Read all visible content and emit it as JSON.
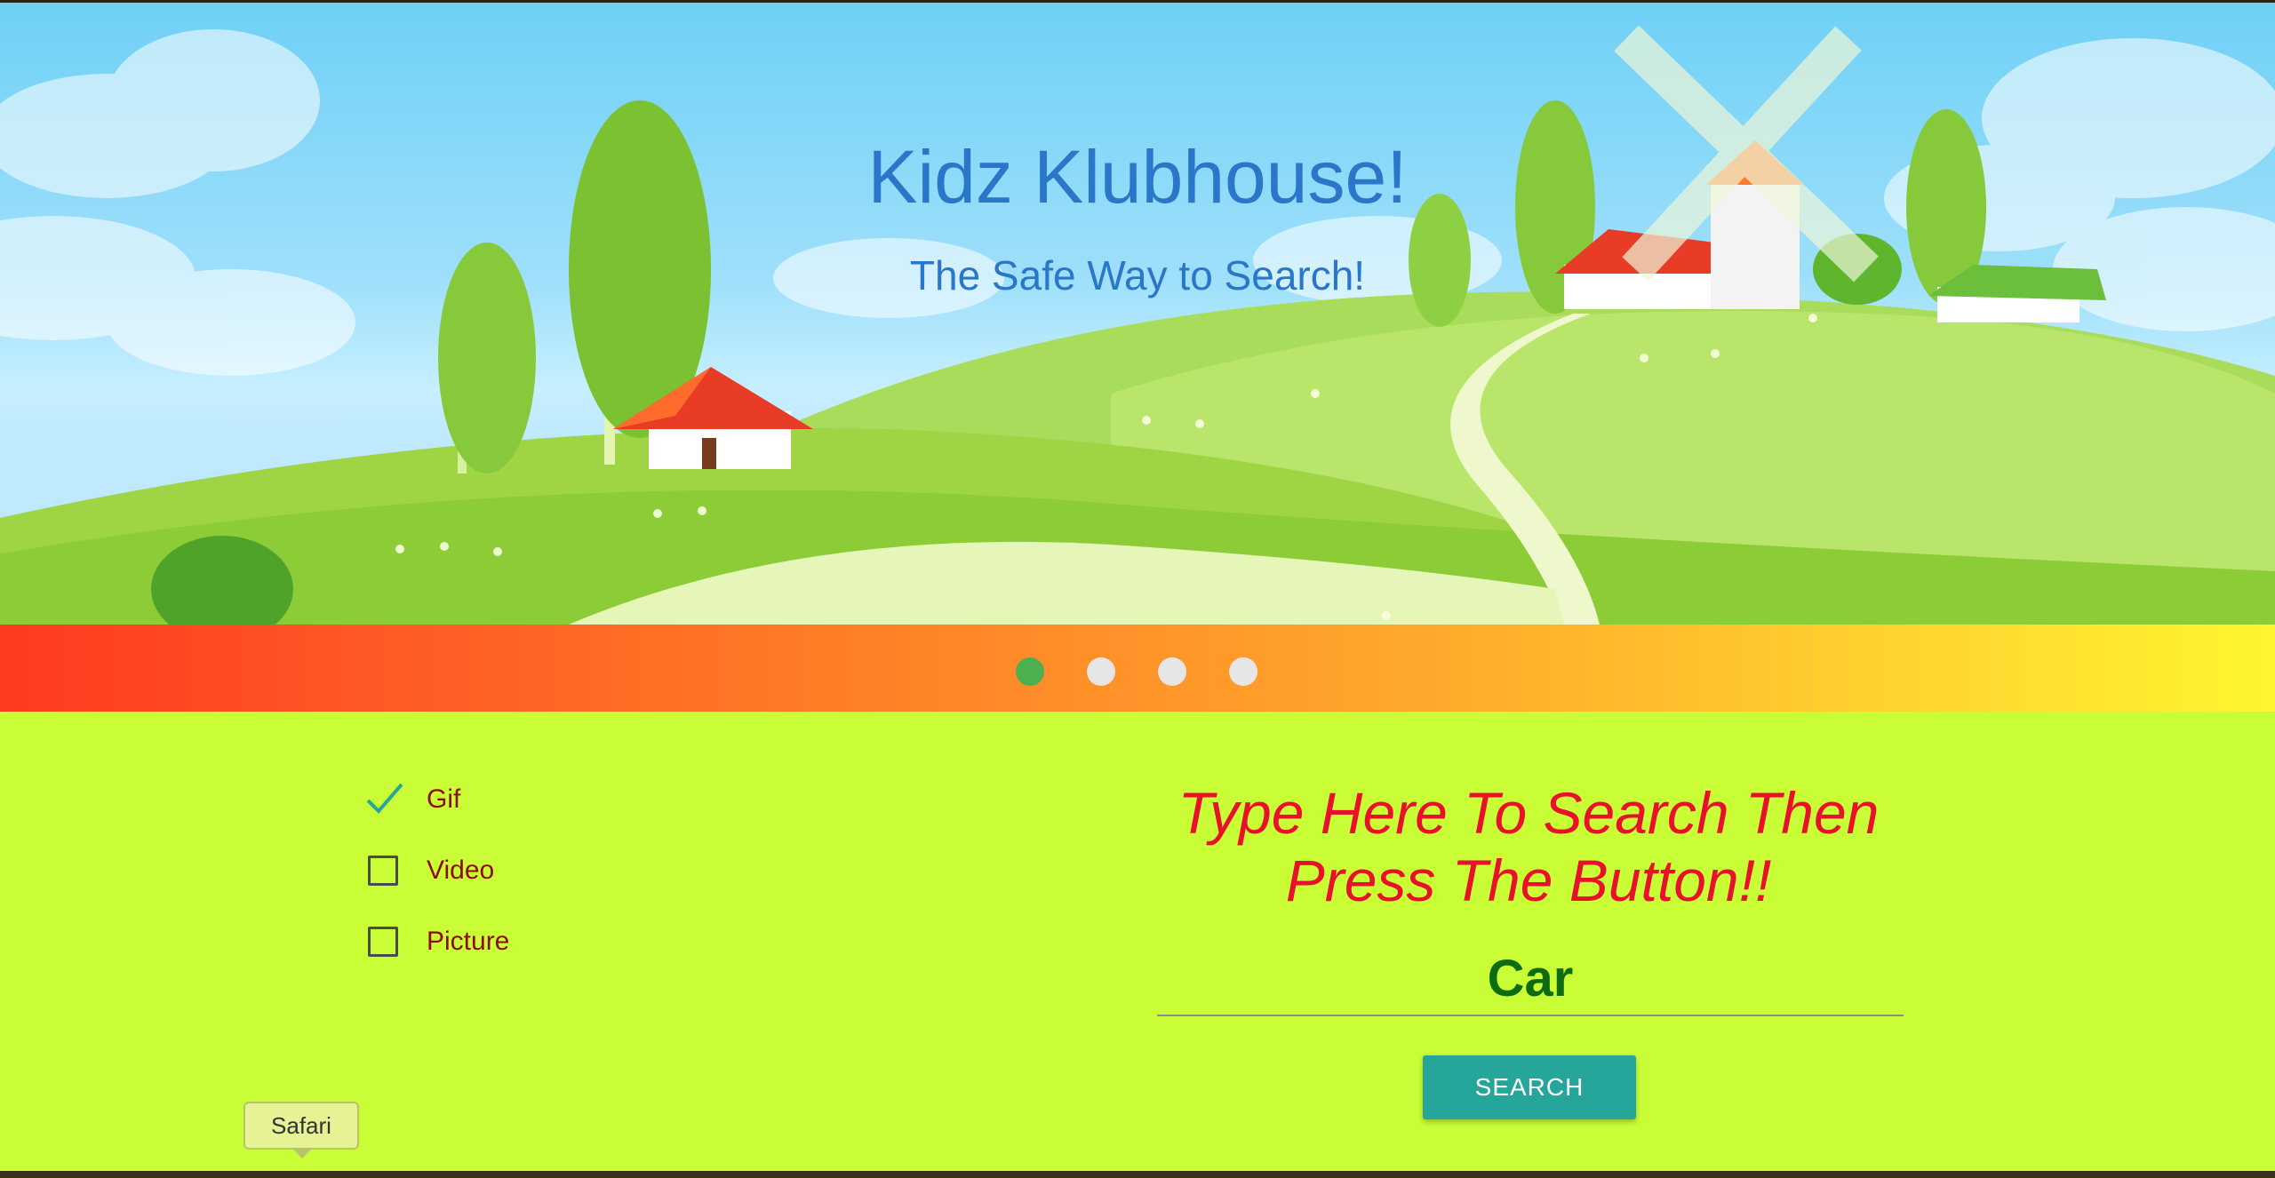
{
  "hero": {
    "title": "Kidz Klubhouse!",
    "subtitle": "The Safe Way to Search!"
  },
  "carousel": {
    "slide_count": 4,
    "active_index": 0,
    "active_color": "#4caf50",
    "inactive_color": "#e6e6e6"
  },
  "filters": {
    "options": [
      {
        "label": "Gif",
        "checked": true,
        "icon": "checkmark-icon"
      },
      {
        "label": "Video",
        "checked": false,
        "icon": "checkbox-icon"
      },
      {
        "label": "Picture",
        "checked": false,
        "icon": "checkbox-icon"
      }
    ]
  },
  "search": {
    "heading": "Type Here To Search Then Press The Button!!",
    "value": "Car",
    "button_label": "SEARCH"
  },
  "tooltip": {
    "text": "Safari"
  },
  "colors": {
    "panel_bg": "#c9fd35",
    "heading_red": "#e8102a",
    "input_green": "#0d6b10",
    "button_teal": "#26a69a",
    "title_blue": "#2a76c9",
    "label_red": "#8b0d0d"
  }
}
